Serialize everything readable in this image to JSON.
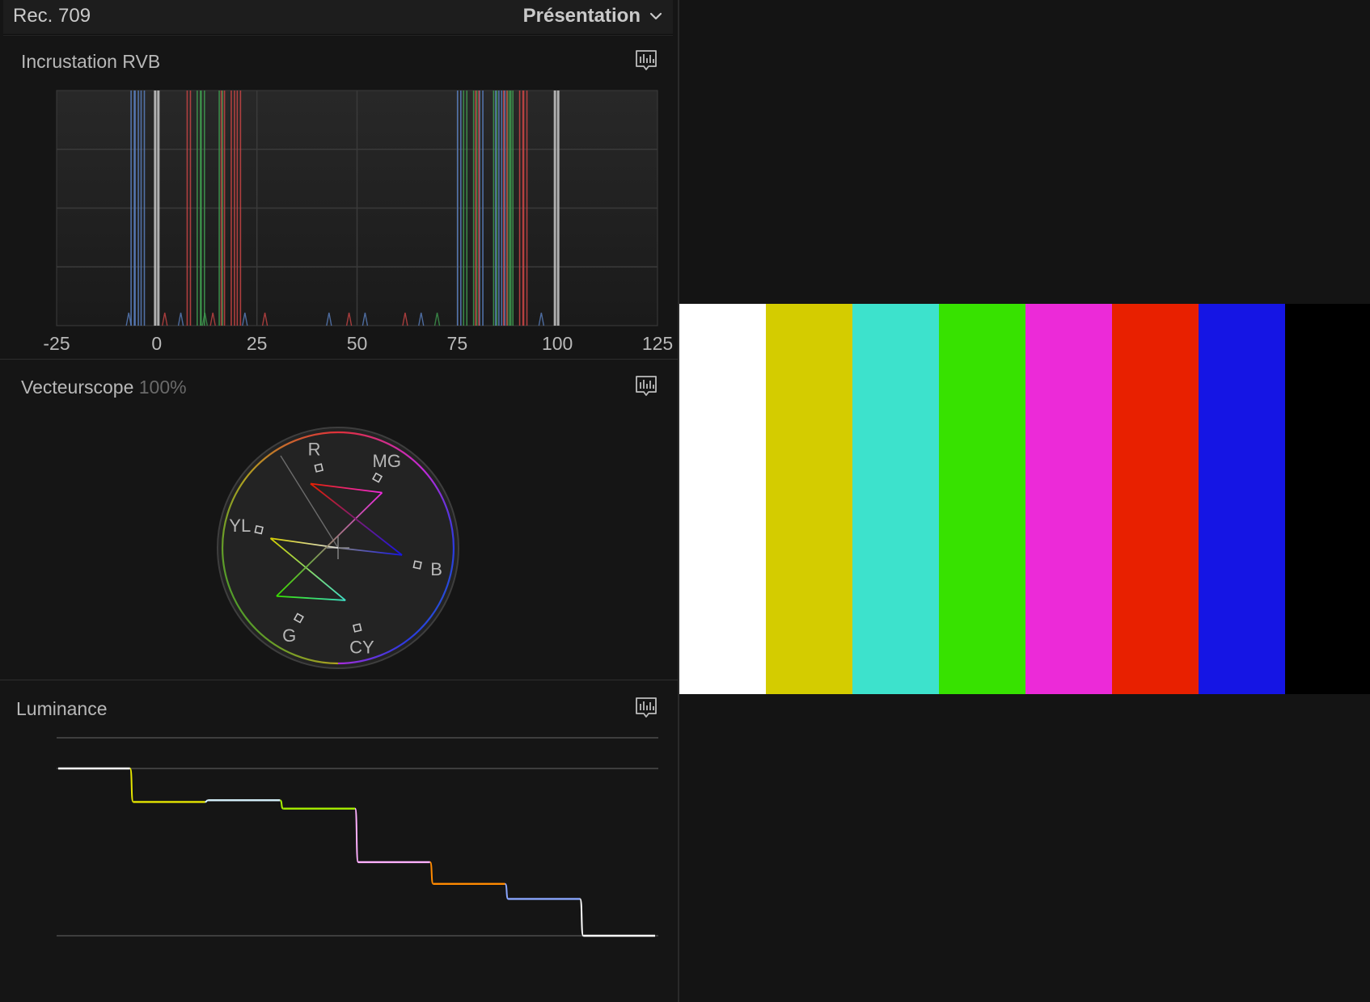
{
  "header": {
    "standard": "Rec. 709",
    "view_label": "Présentation",
    "view_icon": "chevron-down-icon"
  },
  "histogram": {
    "title": "Incrustation RVB",
    "settings_icon": "scope-settings-icon",
    "x_ticks": [
      "-25",
      "0",
      "25",
      "50",
      "75",
      "100",
      "125"
    ],
    "tick_values": [
      -25,
      0,
      25,
      50,
      75,
      100,
      125
    ],
    "channel_colors": {
      "red": "#c94545",
      "green": "#3f9a4f",
      "blue": "#5a7fbf",
      "luma": "#c8c8c8"
    },
    "peaks": {
      "luma": [
        0,
        99.8
      ],
      "red": [
        8,
        16.5,
        19,
        20.5,
        80,
        87,
        91,
        92
      ],
      "green": [
        10.5,
        11.5,
        16,
        77,
        79.5,
        84.5,
        88,
        88.5
      ],
      "blue": [
        -6,
        -5,
        -3.5,
        75.5,
        81,
        85,
        86.5
      ]
    }
  },
  "vectorscope": {
    "title": "Vecteurscope",
    "zoom": "100%",
    "settings_icon": "scope-settings-icon",
    "targets": [
      {
        "label": "R",
        "angle": 103.5,
        "sat": 0.712
      },
      {
        "label": "MG",
        "angle": 60.8,
        "sat": 0.696
      },
      {
        "label": "B",
        "angle": -12.1,
        "sat": 0.702
      },
      {
        "label": "YL",
        "angle": 167.1,
        "sat": 0.702
      },
      {
        "label": "G",
        "angle": 240.8,
        "sat": 0.696
      },
      {
        "label": "CY",
        "angle": 283.5,
        "sat": 0.712
      }
    ],
    "trace": [
      {
        "u": 0,
        "v": 0,
        "color": "#dddddd"
      },
      {
        "u": -0.584,
        "v": 0.083,
        "color": "#d8d000"
      },
      {
        "u": 0.064,
        "v": -0.454,
        "color": "#3ee0c8"
      },
      {
        "u": -0.532,
        "v": -0.418,
        "color": "#38e000"
      },
      {
        "u": 0.381,
        "v": 0.478,
        "color": "#f02ae0"
      },
      {
        "u": -0.238,
        "v": 0.556,
        "color": "#e82000"
      },
      {
        "u": 0.553,
        "v": -0.062,
        "color": "#1515e8"
      },
      {
        "u": 0,
        "v": 0,
        "color": "#888888"
      }
    ]
  },
  "luminance": {
    "title": "Luminance",
    "settings_icon": "scope-settings-icon",
    "steps": [
      {
        "level": 100,
        "color": "#ffffff"
      },
      {
        "level": 80,
        "color": "#e6e600"
      },
      {
        "level": 81,
        "color": "#d8f4ff"
      },
      {
        "level": 76,
        "color": "#a8f000"
      },
      {
        "level": 44,
        "color": "#ffb0ff"
      },
      {
        "level": 31,
        "color": "#ff8a00"
      },
      {
        "level": 22,
        "color": "#8aa6ff"
      },
      {
        "level": 0,
        "color": "#ffffff"
      }
    ]
  },
  "viewer": {
    "bars": [
      "#ffffff",
      "#d4cc00",
      "#3de2cc",
      "#37e200",
      "#ec2ad8",
      "#e82000",
      "#1515e4",
      "#000000"
    ]
  }
}
